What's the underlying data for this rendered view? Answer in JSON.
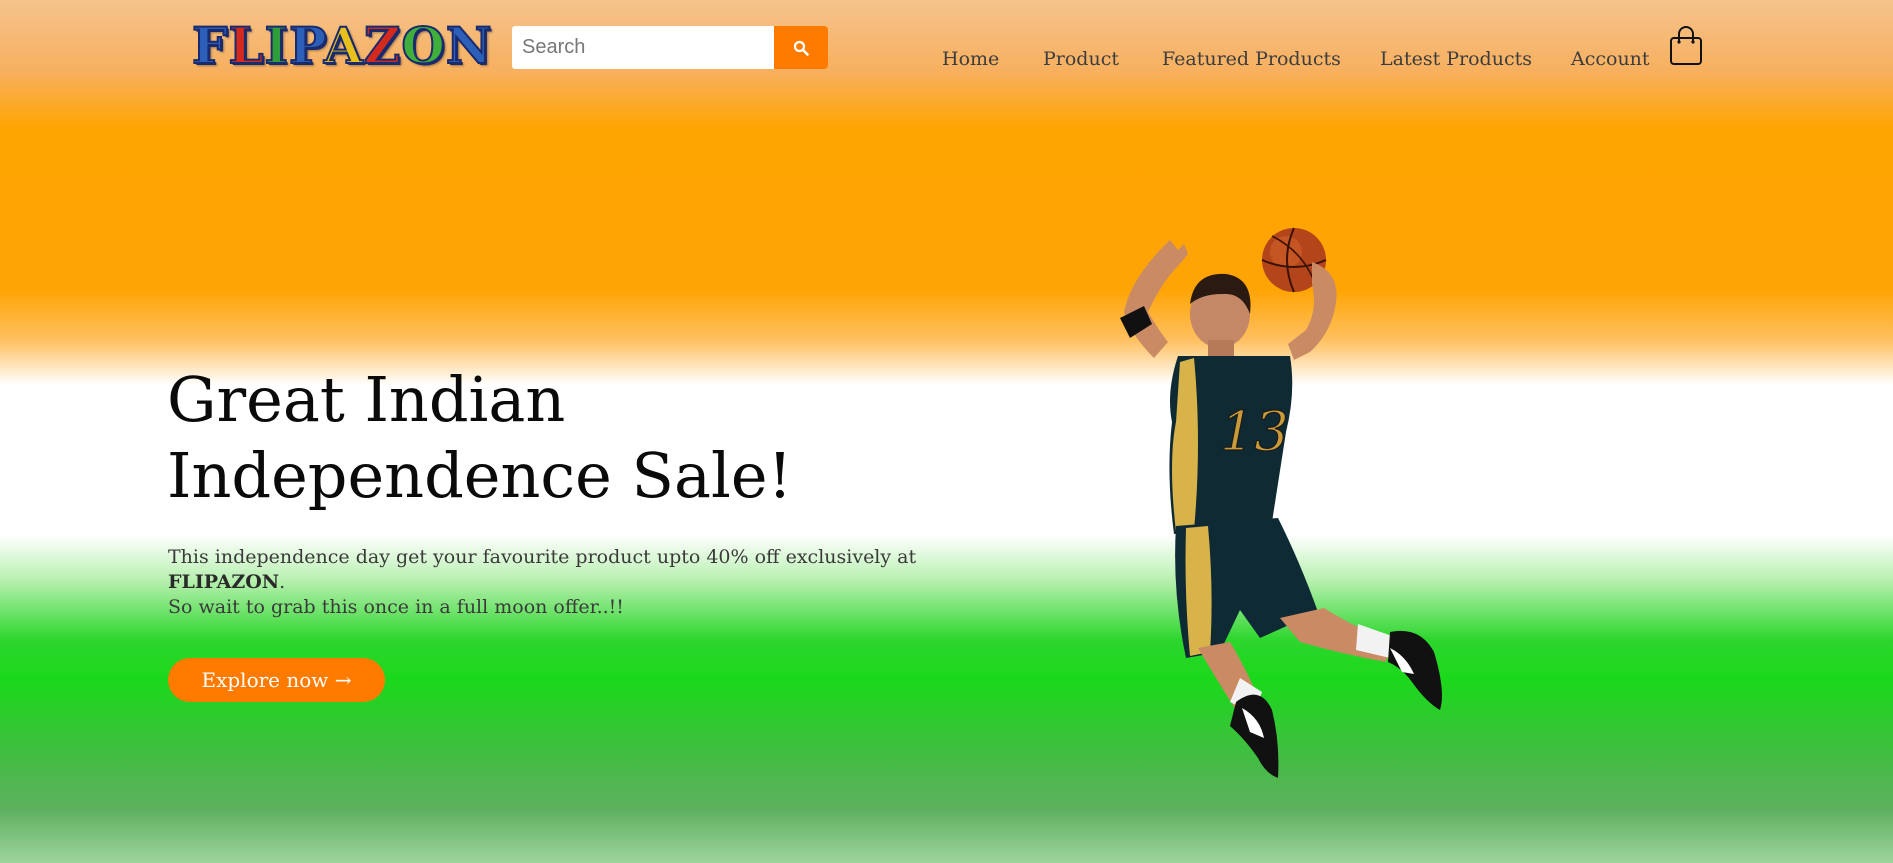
{
  "brand": {
    "logo_letters": [
      {
        "char": "F",
        "color": "#2c5fb8"
      },
      {
        "char": "L",
        "color": "#d42a1e"
      },
      {
        "char": "I",
        "color": "#2e9e3a"
      },
      {
        "char": "P",
        "color": "#2c5fb8"
      },
      {
        "char": "A",
        "color": "#e8c21a"
      },
      {
        "char": "Z",
        "color": "#d42a1e"
      },
      {
        "char": "O",
        "color": "#3fae3a"
      },
      {
        "char": "N",
        "color": "#2c5fb8"
      }
    ]
  },
  "search": {
    "placeholder": "Search",
    "value": "",
    "button_icon": "search-icon"
  },
  "nav": {
    "items": [
      {
        "label": "Home"
      },
      {
        "label": "Product"
      },
      {
        "label": "Featured Products"
      },
      {
        "label": "Latest Products"
      },
      {
        "label": "Account"
      }
    ],
    "cart_icon": "shopping-bag-icon"
  },
  "hero": {
    "title_line1": "Great Indian",
    "title_line2": "Independence Sale!",
    "desc_line1": "This independence day get your favourite product upto 40% off exclusively at",
    "desc_brand": "FLIPAZON",
    "desc_brand_suffix": ".",
    "desc_line2": "So wait to grab this once in a full moon offer..!!",
    "cta_label": "Explore now →",
    "image": "basketball-player-jumping"
  },
  "colors": {
    "accent": "#ff7b00",
    "saffron": "#ffa500",
    "green": "#1bd81b",
    "text_dark": "#0a0a0a"
  }
}
